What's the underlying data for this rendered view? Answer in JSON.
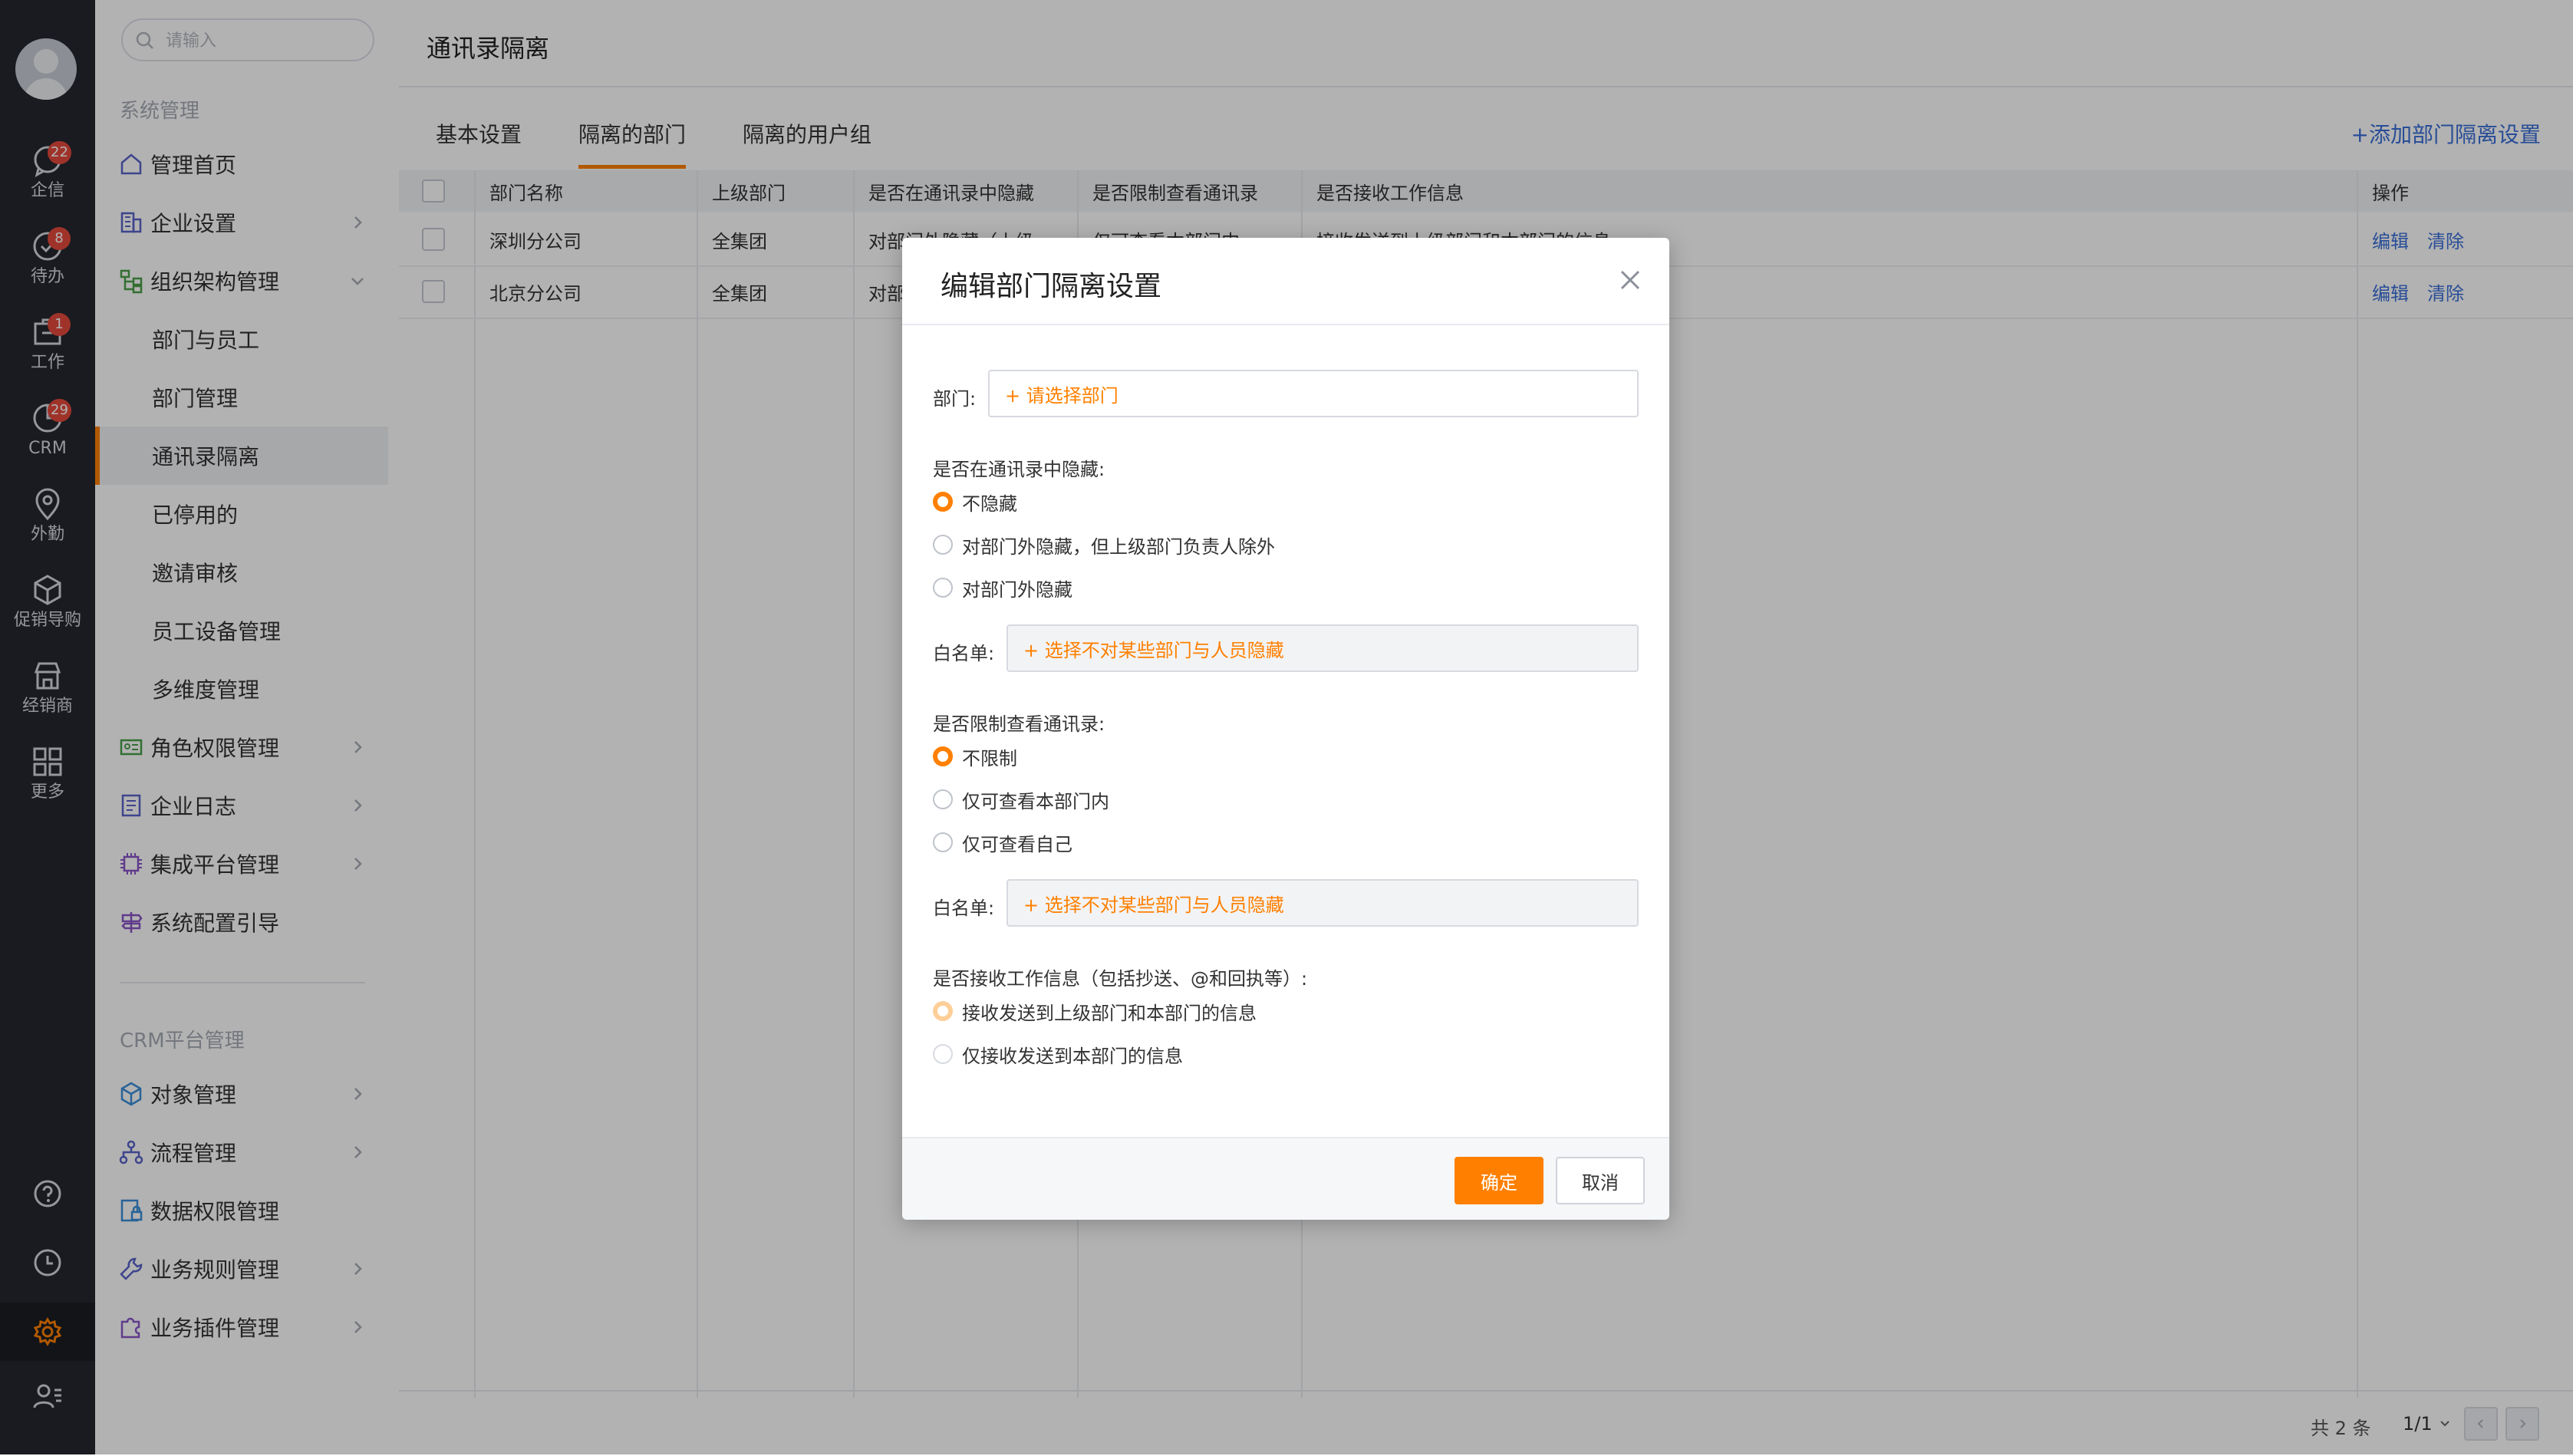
{
  "rail": {
    "items": [
      {
        "label": "企信",
        "badge": "22"
      },
      {
        "label": "待办",
        "badge": "8"
      },
      {
        "label": "工作",
        "badge": "1"
      },
      {
        "label": "CRM",
        "badge": "29"
      },
      {
        "label": "外勤",
        "badge": ""
      },
      {
        "label": "促销导购",
        "badge": ""
      },
      {
        "label": "经销商",
        "badge": ""
      },
      {
        "label": "更多",
        "badge": ""
      }
    ]
  },
  "sidebar": {
    "search_placeholder": "请输入",
    "section1_title": "系统管理",
    "section2_title": "CRM平台管理",
    "items": [
      {
        "label": "管理首页",
        "icon": "home-icon"
      },
      {
        "label": "企业设置",
        "icon": "building-icon"
      },
      {
        "label": "组织架构管理",
        "icon": "org-tree-icon"
      },
      {
        "label": "部门与员工"
      },
      {
        "label": "部门管理"
      },
      {
        "label": "通讯录隔离"
      },
      {
        "label": "已停用的"
      },
      {
        "label": "邀请审核"
      },
      {
        "label": "员工设备管理"
      },
      {
        "label": "多维度管理"
      },
      {
        "label": "角色权限管理",
        "icon": "id-card-icon"
      },
      {
        "label": "企业日志",
        "icon": "log-icon"
      },
      {
        "label": "集成平台管理",
        "icon": "chip-icon"
      },
      {
        "label": "系统配置引导",
        "icon": "signpost-icon"
      }
    ],
    "crm_items": [
      {
        "label": "对象管理",
        "icon": "cube-icon"
      },
      {
        "label": "流程管理",
        "icon": "flow-icon"
      },
      {
        "label": "数据权限管理",
        "icon": "data-lock-icon"
      },
      {
        "label": "业务规则管理",
        "icon": "wrench-icon"
      },
      {
        "label": "业务插件管理",
        "icon": "puzzle-icon"
      }
    ]
  },
  "main": {
    "title": "通讯录隔离",
    "tabs": [
      "基本设置",
      "隔离的部门",
      "隔离的用户组"
    ],
    "add_link": "+添加部门隔离设置",
    "table": {
      "headers": [
        "部门名称",
        "上级部门",
        "是否在通讯录中隐藏",
        "是否限制查看通讯录",
        "是否接收工作信息",
        "操作"
      ],
      "rows": [
        {
          "name": "深圳分公司",
          "parent": "全集团",
          "hide": "对部门外隐藏（上级",
          "limit": "仅可查看本部门内",
          "receive": "接收发送到上级部门和本部门的信息"
        },
        {
          "name": "北京分公司",
          "parent": "全集团",
          "hide": "对部",
          "limit": "",
          "receive": ""
        }
      ],
      "action_edit": "编辑",
      "action_clear": "清除"
    },
    "footer": {
      "total": "共 2 条",
      "page": "1/1"
    }
  },
  "modal": {
    "title": "编辑部门隔离设置",
    "dept_label": "部门:",
    "dept_placeholder": "+ 请选择部门",
    "q1": "是否在通讯录中隐藏:",
    "q1_options": [
      "不隐藏",
      "对部门外隐藏，但上级部门负责人除外",
      "对部门外隐藏"
    ],
    "whitelist_label": "白名单:",
    "whitelist_placeholder": "+ 选择不对某些部门与人员隐藏",
    "q2": "是否限制查看通讯录:",
    "q2_options": [
      "不限制",
      "仅可查看本部门内",
      "仅可查看自己"
    ],
    "q3": "是否接收工作信息（包括抄送、@和回执等）:",
    "q3_options": [
      "接收发送到上级部门和本部门的信息",
      "仅接收发送到本部门的信息"
    ],
    "confirm": "确定",
    "cancel": "取消"
  },
  "colors": {
    "accent": "#ff8000",
    "link": "#3a6fd8",
    "rail_bg": "#24272e",
    "badge": "#e4493d"
  }
}
